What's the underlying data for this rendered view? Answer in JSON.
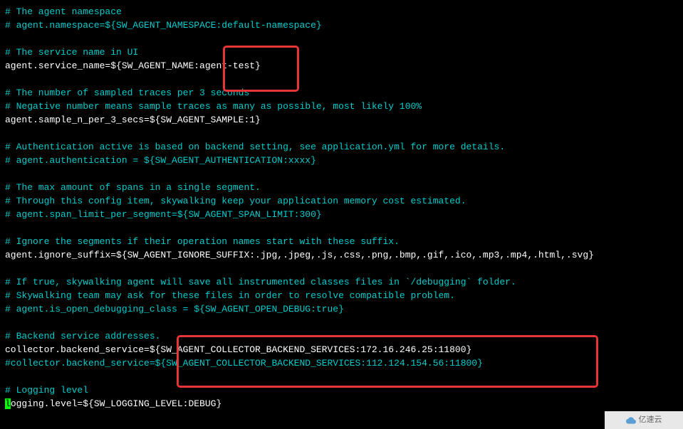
{
  "lines": [
    {
      "type": "comment",
      "text": "# The agent namespace"
    },
    {
      "type": "comment",
      "text": "# agent.namespace=${SW_AGENT_NAMESPACE:default-namespace}"
    },
    {
      "type": "blank",
      "text": ""
    },
    {
      "type": "comment",
      "text": "# The service name in UI"
    },
    {
      "type": "setting",
      "text": "agent.service_name=${SW_AGENT_NAME:agent-test}"
    },
    {
      "type": "blank",
      "text": ""
    },
    {
      "type": "comment",
      "text": "# The number of sampled traces per 3 seconds"
    },
    {
      "type": "comment",
      "text": "# Negative number means sample traces as many as possible, most likely 100%"
    },
    {
      "type": "setting",
      "text": "agent.sample_n_per_3_secs=${SW_AGENT_SAMPLE:1}"
    },
    {
      "type": "blank",
      "text": ""
    },
    {
      "type": "comment",
      "text": "# Authentication active is based on backend setting, see application.yml for more details."
    },
    {
      "type": "comment",
      "text": "# agent.authentication = ${SW_AGENT_AUTHENTICATION:xxxx}"
    },
    {
      "type": "blank",
      "text": ""
    },
    {
      "type": "comment",
      "text": "# The max amount of spans in a single segment."
    },
    {
      "type": "comment",
      "text": "# Through this config item, skywalking keep your application memory cost estimated."
    },
    {
      "type": "comment",
      "text": "# agent.span_limit_per_segment=${SW_AGENT_SPAN_LIMIT:300}"
    },
    {
      "type": "blank",
      "text": ""
    },
    {
      "type": "comment",
      "text": "# Ignore the segments if their operation names start with these suffix."
    },
    {
      "type": "setting",
      "text": "agent.ignore_suffix=${SW_AGENT_IGNORE_SUFFIX:.jpg,.jpeg,.js,.css,.png,.bmp,.gif,.ico,.mp3,.mp4,.html,.svg}"
    },
    {
      "type": "blank",
      "text": ""
    },
    {
      "type": "comment",
      "text": "# If true, skywalking agent will save all instrumented classes files in `/debugging` folder."
    },
    {
      "type": "comment",
      "text": "# Skywalking team may ask for these files in order to resolve compatible problem."
    },
    {
      "type": "comment",
      "text": "# agent.is_open_debugging_class = ${SW_AGENT_OPEN_DEBUG:true}"
    },
    {
      "type": "blank",
      "text": ""
    },
    {
      "type": "comment",
      "text": "# Backend service addresses."
    },
    {
      "type": "setting",
      "text": "collector.backend_service=${SW_AGENT_COLLECTOR_BACKEND_SERVICES:172.16.246.25:11800}"
    },
    {
      "type": "comment",
      "text": "#collector.backend_service=${SW_AGENT_COLLECTOR_BACKEND_SERVICES:112.124.154.56:11800}"
    },
    {
      "type": "blank",
      "text": ""
    },
    {
      "type": "comment",
      "text": "# Logging level"
    },
    {
      "type": "setting-cursor",
      "text": "logging.level=${SW_LOGGING_LEVEL:DEBUG}",
      "cursorChar": "l"
    }
  ],
  "watermark": {
    "text": "亿速云"
  }
}
